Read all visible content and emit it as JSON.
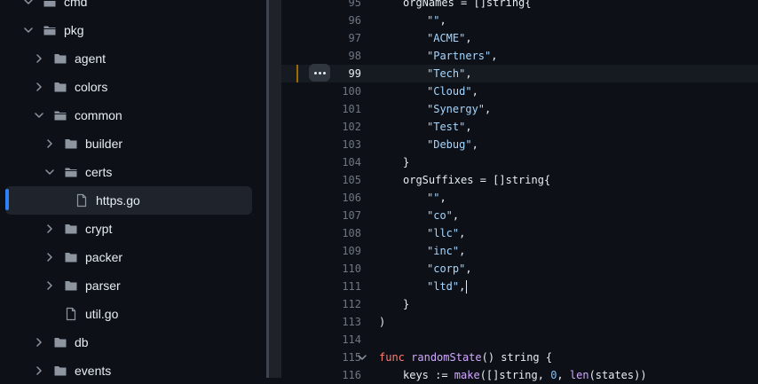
{
  "tree": {
    "items": [
      {
        "label": "cmd",
        "type": "folder",
        "open": true,
        "depth": 1
      },
      {
        "label": "pkg",
        "type": "folder",
        "open": true,
        "depth": 1
      },
      {
        "label": "agent",
        "type": "folder",
        "open": false,
        "depth": 2
      },
      {
        "label": "colors",
        "type": "folder",
        "open": false,
        "depth": 2
      },
      {
        "label": "common",
        "type": "folder",
        "open": true,
        "depth": 2
      },
      {
        "label": "builder",
        "type": "folder",
        "open": false,
        "depth": 3
      },
      {
        "label": "certs",
        "type": "folder",
        "open": true,
        "depth": 3
      },
      {
        "label": "https.go",
        "type": "file",
        "depth": 4,
        "selected": true
      },
      {
        "label": "crypt",
        "type": "folder",
        "open": false,
        "depth": 3
      },
      {
        "label": "packer",
        "type": "folder",
        "open": false,
        "depth": 3
      },
      {
        "label": "parser",
        "type": "folder",
        "open": false,
        "depth": 3
      },
      {
        "label": "util.go",
        "type": "file",
        "depth": 3
      },
      {
        "label": "db",
        "type": "folder",
        "open": false,
        "depth": 2
      },
      {
        "label": "events",
        "type": "folder",
        "open": false,
        "depth": 2
      }
    ]
  },
  "editor": {
    "lines": [
      {
        "n": "95",
        "indent": 1,
        "code": "orgNames = []string{"
      },
      {
        "n": "96",
        "indent": 2,
        "code": "\"\","
      },
      {
        "n": "97",
        "indent": 2,
        "code": "\"ACME\","
      },
      {
        "n": "98",
        "indent": 2,
        "code": "\"Partners\","
      },
      {
        "n": "99",
        "indent": 2,
        "code": "\"Tech\",",
        "highlight": true
      },
      {
        "n": "100",
        "indent": 2,
        "code": "\"Cloud\","
      },
      {
        "n": "101",
        "indent": 2,
        "code": "\"Synergy\","
      },
      {
        "n": "102",
        "indent": 2,
        "code": "\"Test\","
      },
      {
        "n": "103",
        "indent": 2,
        "code": "\"Debug\","
      },
      {
        "n": "104",
        "indent": 1,
        "code": "}"
      },
      {
        "n": "105",
        "indent": 1,
        "code": "orgSuffixes = []string{"
      },
      {
        "n": "106",
        "indent": 2,
        "code": "\"\","
      },
      {
        "n": "107",
        "indent": 2,
        "code": "\"co\","
      },
      {
        "n": "108",
        "indent": 2,
        "code": "\"llc\","
      },
      {
        "n": "109",
        "indent": 2,
        "code": "\"inc\","
      },
      {
        "n": "110",
        "indent": 2,
        "code": "\"corp\","
      },
      {
        "n": "111",
        "indent": 2,
        "code": "\"ltd\",",
        "caret": true
      },
      {
        "n": "112",
        "indent": 1,
        "code": "}"
      },
      {
        "n": "113",
        "indent": 0,
        "code": ")"
      },
      {
        "n": "114",
        "indent": 0,
        "code": ""
      },
      {
        "n": "115",
        "indent": 0,
        "code": "func randomState() string {",
        "fold": true
      },
      {
        "n": "116",
        "indent": 1,
        "code": "keys := make([]string, 0, len(states))"
      }
    ]
  },
  "colors": {
    "background": "#0d1117",
    "selection_accent": "#2f81f7",
    "line_highlight_mark": "#9e6a03",
    "string": "#a5d6ff",
    "keyword": "#ff7b72",
    "function": "#d2a8ff"
  }
}
